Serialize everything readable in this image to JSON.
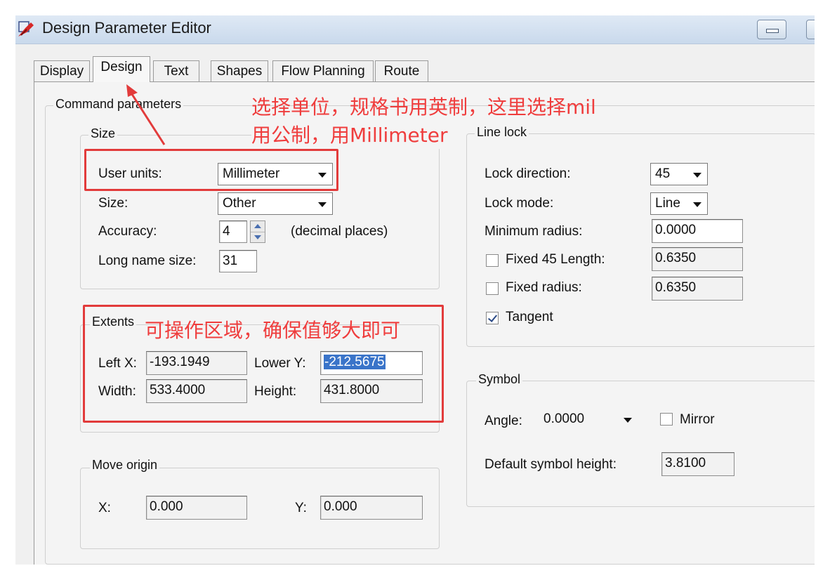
{
  "window": {
    "title": "Design Parameter Editor"
  },
  "tabs": [
    {
      "label": "Display"
    },
    {
      "label": "Design"
    },
    {
      "label": "Text"
    },
    {
      "label": "Shapes"
    },
    {
      "label": "Flow Planning"
    },
    {
      "label": "Route"
    }
  ],
  "command_parameters": {
    "label": "Command parameters",
    "size_group": {
      "label": "Size",
      "user_units_label": "User units:",
      "user_units_value": "Millimeter",
      "size_label": "Size:",
      "size_value": "Other",
      "accuracy_label": "Accuracy:",
      "accuracy_value": "4",
      "accuracy_suffix": "(decimal places)",
      "long_name_label": "Long name size:",
      "long_name_value": "31"
    },
    "extents": {
      "label": "Extents",
      "left_x_label": "Left X:",
      "left_x_value": "-193.1949",
      "lower_y_label": "Lower Y:",
      "lower_y_value": "-212.5675",
      "width_label": "Width:",
      "width_value": "533.4000",
      "height_label": "Height:",
      "height_value": "431.8000"
    },
    "move_origin": {
      "label": "Move origin",
      "x_label": "X:",
      "x_value": "0.000",
      "y_label": "Y:",
      "y_value": "0.000"
    }
  },
  "line_lock": {
    "label": "Line lock",
    "lock_direction_label": "Lock direction:",
    "lock_direction_value": "45",
    "lock_mode_label": "Lock mode:",
    "lock_mode_value": "Line",
    "min_radius_label": "Minimum radius:",
    "min_radius_value": "0.0000",
    "fixed45_label": "Fixed 45 Length:",
    "fixed45_checked": false,
    "fixed45_value": "0.6350",
    "fixed_radius_label": "Fixed radius:",
    "fixed_radius_checked": false,
    "fixed_radius_value": "0.6350",
    "tangent_label": "Tangent",
    "tangent_checked": true
  },
  "symbol": {
    "label": "Symbol",
    "angle_label": "Angle:",
    "angle_value": "0.0000",
    "mirror_label": "Mirror",
    "mirror_checked": false,
    "default_height_label": "Default symbol height:",
    "default_height_value": "3.8100"
  },
  "annotations": {
    "units_line1": "选择单位，规格书用英制，这里选择mil",
    "units_line2": "用公制，用Millimeter",
    "extents_note": "可操作区域，确保值够大即可",
    "color": "#e23b3b"
  }
}
